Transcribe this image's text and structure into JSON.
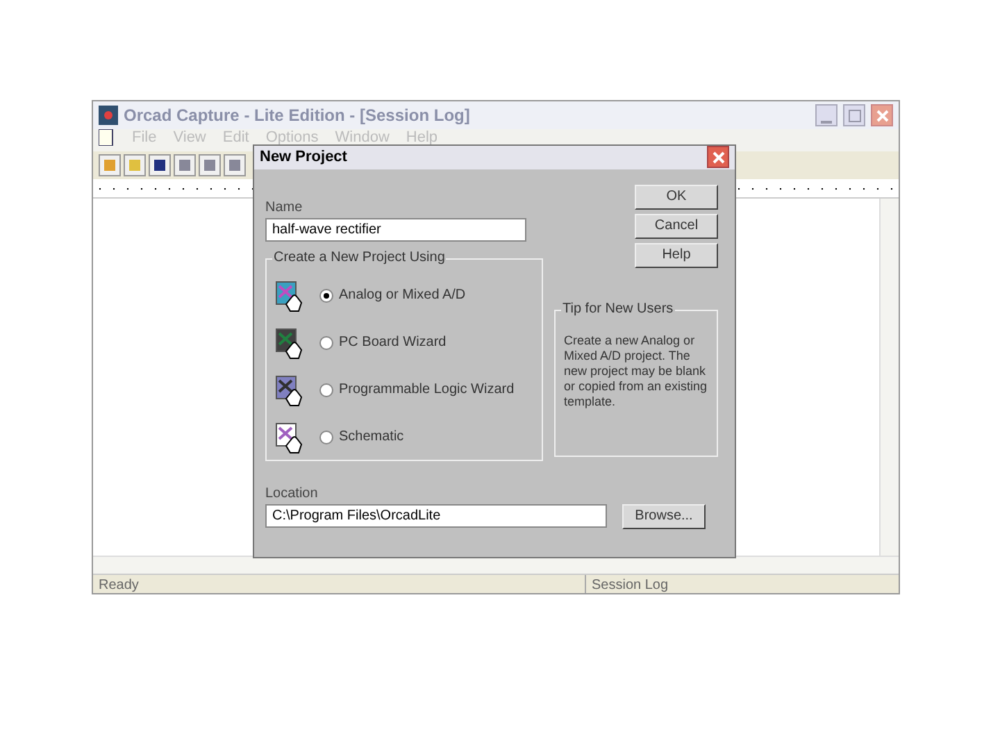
{
  "window": {
    "title": "Orcad Capture - Lite Edition - [Session Log]"
  },
  "menu": [
    "File",
    "View",
    "Edit",
    "Options",
    "Window",
    "Help"
  ],
  "status_bar": [
    "Ready",
    "Session Log"
  ],
  "dialog": {
    "title": "New Project",
    "name_label": "Name",
    "name_value": "half-wave rectifier",
    "buttons": [
      "OK",
      "Cancel",
      "Help"
    ],
    "group_title": "Create a New Project Using",
    "options": [
      {
        "label": "Analog or Mixed A/D",
        "selected": true
      },
      {
        "label": "PC Board Wizard",
        "selected": false
      },
      {
        "label": "Programmable Logic Wizard",
        "selected": false
      },
      {
        "label": "Schematic",
        "selected": false
      }
    ],
    "tip_title": "Tip for New Users",
    "tip_text": "Create a new Analog or Mixed A/D project. The new project may be blank or copied from an existing template.",
    "location_label": "Location",
    "location_value": "C:\\Program Files\\OrcadLite",
    "browse": "Browse..."
  }
}
